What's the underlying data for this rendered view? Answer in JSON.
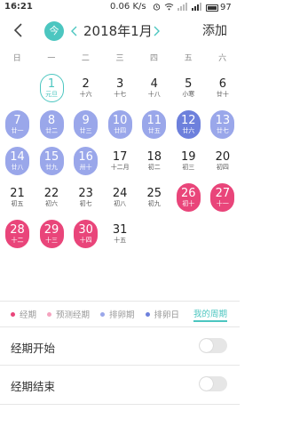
{
  "status_bar": {
    "time": "16:21",
    "speed": "0.06 K/s",
    "battery_level": "97"
  },
  "toolbar": {
    "today_label": "今",
    "month_title": "2018年1月",
    "add_label": "添加"
  },
  "weekdays": [
    "日",
    "一",
    "二",
    "三",
    "四",
    "五",
    "六"
  ],
  "calendar": {
    "weeks": [
      [
        {
          "num": "",
          "sub": "",
          "state": "empty"
        },
        {
          "num": "1",
          "sub": "元旦",
          "state": "today"
        },
        {
          "num": "2",
          "sub": "十六",
          "state": "normal"
        },
        {
          "num": "3",
          "sub": "十七",
          "state": "normal"
        },
        {
          "num": "4",
          "sub": "十八",
          "state": "normal"
        },
        {
          "num": "5",
          "sub": "小寒",
          "state": "normal"
        },
        {
          "num": "6",
          "sub": "廿十",
          "state": "normal"
        }
      ],
      [
        {
          "num": "7",
          "sub": "廿一",
          "state": "ovulation"
        },
        {
          "num": "8",
          "sub": "廿二",
          "state": "ovulation"
        },
        {
          "num": "9",
          "sub": "廿三",
          "state": "ovulation"
        },
        {
          "num": "10",
          "sub": "廿四",
          "state": "ovulation"
        },
        {
          "num": "11",
          "sub": "廿五",
          "state": "ovulation"
        },
        {
          "num": "12",
          "sub": "廿六",
          "state": "ovulation-day"
        },
        {
          "num": "13",
          "sub": "廿七",
          "state": "ovulation"
        }
      ],
      [
        {
          "num": "14",
          "sub": "廿八",
          "state": "ovulation"
        },
        {
          "num": "15",
          "sub": "廿九",
          "state": "ovulation"
        },
        {
          "num": "16",
          "sub": "卅十",
          "state": "ovulation"
        },
        {
          "num": "17",
          "sub": "十二月",
          "state": "normal"
        },
        {
          "num": "18",
          "sub": "初二",
          "state": "normal"
        },
        {
          "num": "19",
          "sub": "初三",
          "state": "normal"
        },
        {
          "num": "20",
          "sub": "初四",
          "state": "normal"
        }
      ],
      [
        {
          "num": "21",
          "sub": "初五",
          "state": "normal"
        },
        {
          "num": "22",
          "sub": "初六",
          "state": "normal"
        },
        {
          "num": "23",
          "sub": "初七",
          "state": "normal"
        },
        {
          "num": "24",
          "sub": "初八",
          "state": "normal"
        },
        {
          "num": "25",
          "sub": "初九",
          "state": "normal"
        },
        {
          "num": "26",
          "sub": "初十",
          "state": "period"
        },
        {
          "num": "27",
          "sub": "十一",
          "state": "period"
        }
      ],
      [
        {
          "num": "28",
          "sub": "十二",
          "state": "period"
        },
        {
          "num": "29",
          "sub": "十三",
          "state": "period"
        },
        {
          "num": "30",
          "sub": "十四",
          "state": "period"
        },
        {
          "num": "31",
          "sub": "十五",
          "state": "normal"
        },
        {
          "num": "",
          "sub": "",
          "state": "empty"
        },
        {
          "num": "",
          "sub": "",
          "state": "empty"
        },
        {
          "num": "",
          "sub": "",
          "state": "empty"
        }
      ]
    ]
  },
  "legend": {
    "items": [
      {
        "label": "经期",
        "color": "#e9457a"
      },
      {
        "label": "预测经期",
        "color": "#f5a3bf"
      },
      {
        "label": "排卵期",
        "color": "#9aa7ea"
      },
      {
        "label": "排卵日",
        "color": "#6d80dc"
      }
    ],
    "cycle_label": "我的周期"
  },
  "settings": {
    "period_start_label": "经期开始",
    "period_end_label": "经期结束"
  },
  "colors": {
    "accent": "#4cc6c0",
    "period": "#e9457a",
    "ovulation": "#9aa7ea",
    "ovulation_day": "#6d80dc"
  }
}
